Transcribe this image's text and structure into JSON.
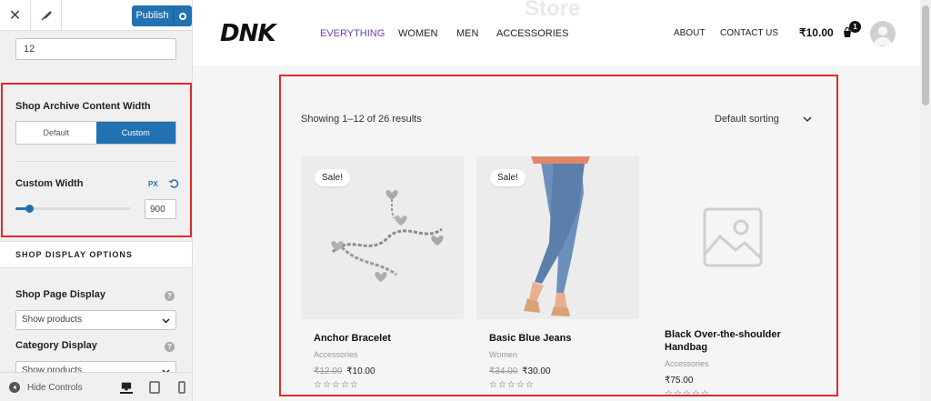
{
  "sidebar": {
    "publish_label": "Publish",
    "products_per_page_value": "12",
    "archive_width": {
      "title": "Shop Archive Content Width",
      "default_label": "Default",
      "custom_label": "Custom",
      "selected": "Custom"
    },
    "custom_width": {
      "label": "Custom Width",
      "unit": "PX",
      "value": "900",
      "slider_fraction": 0.12
    },
    "shop_display_header": "SHOP DISPLAY OPTIONS",
    "shop_page_display": {
      "label": "Shop Page Display",
      "value": "Show products"
    },
    "category_display": {
      "label": "Category Display",
      "value": "Show products"
    },
    "help_glyph": "?",
    "footer": {
      "hide_controls_label": "Hide Controls",
      "active_device": "desktop"
    }
  },
  "preview": {
    "ghost_title": "Store",
    "logo": "DNK",
    "nav": [
      "EVERYTHING",
      "WOMEN",
      "MEN",
      "ACCESSORIES"
    ],
    "nav_right": [
      "ABOUT",
      "CONTACT US"
    ],
    "cart_total": "₹10.00",
    "cart_count": "1",
    "results_text": "Showing 1–12 of 26 results",
    "sorting_label": "Default sorting",
    "products": [
      {
        "name": "Anchor Bracelet",
        "category": "Accessories",
        "old_price": "₹12.00",
        "price": "₹10.00",
        "sale": "Sale!",
        "stars": "☆☆☆☆☆"
      },
      {
        "name": "Basic Blue Jeans",
        "category": "Women",
        "old_price": "₹34.00",
        "price": "₹30.00",
        "sale": "Sale!",
        "stars": "☆☆☆☆☆"
      },
      {
        "name": "Black Over-the-shoulder Handbag",
        "category": "Accessories",
        "old_price": "",
        "price": "₹75.00",
        "sale": "",
        "stars": "☆☆☆☆☆"
      }
    ]
  },
  "colors": {
    "wp_blue": "#2271b1",
    "highlight_red": "#e02b2b",
    "nav_active": "#6c3fb5"
  },
  "icons": [
    "close-icon",
    "brush-icon",
    "gear-icon",
    "reset-icon",
    "help-icon",
    "chevron-down-icon",
    "collapse-icon",
    "desktop-icon",
    "tablet-icon",
    "mobile-icon",
    "cart-icon",
    "avatar",
    "placeholder-image-icon"
  ]
}
